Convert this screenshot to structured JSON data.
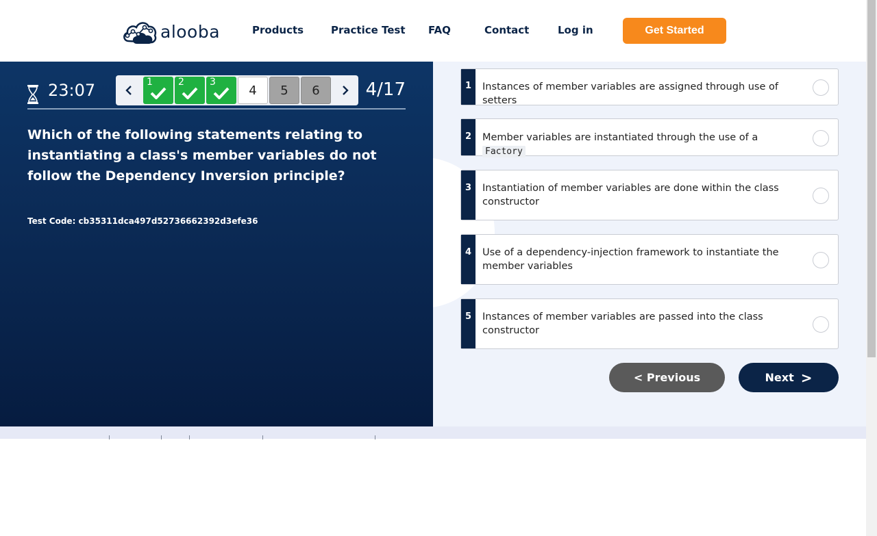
{
  "header": {
    "logo_text": "alooba",
    "nav": [
      "Products",
      "Practice Test",
      "FAQ",
      "Contact",
      "Log in"
    ],
    "cta_label": "Get Started",
    "cta_color": "#f7891c"
  },
  "quiz": {
    "timer": "23:07",
    "progress": "4/17",
    "question_nav": [
      {
        "label": "1",
        "status": "answered"
      },
      {
        "label": "2",
        "status": "answered"
      },
      {
        "label": "3",
        "status": "answered"
      },
      {
        "label": "4",
        "status": "current"
      },
      {
        "label": "5",
        "status": "unanswered"
      },
      {
        "label": "6",
        "status": "unanswered"
      }
    ],
    "question": "Which of the following statements relating to instantiating a class's member variables do not follow the Dependency Inversion principle?",
    "test_code": "Test Code: cb35311dca497d52736662392d3efe36"
  },
  "options": [
    {
      "num": "1",
      "text": "Instances of member variables are assigned through use of setters"
    },
    {
      "num": "2",
      "text_before": "Member variables are instantiated through the use of a",
      "code": "Factory"
    },
    {
      "num": "3",
      "text": "Instantiation of member variables are done within the class constructor"
    },
    {
      "num": "4",
      "text": "Use of a dependency-injection framework to instantiate the member variables"
    },
    {
      "num": "5",
      "text": "Instances of member variables are passed into the class constructor"
    }
  ],
  "buttons": {
    "previous": "< Previous",
    "next": "Next",
    "next_arrow": ">"
  },
  "colors": {
    "navy": "#0b2447",
    "answered_green": "#1fb141",
    "previous_gray": "#5a5a5a"
  }
}
